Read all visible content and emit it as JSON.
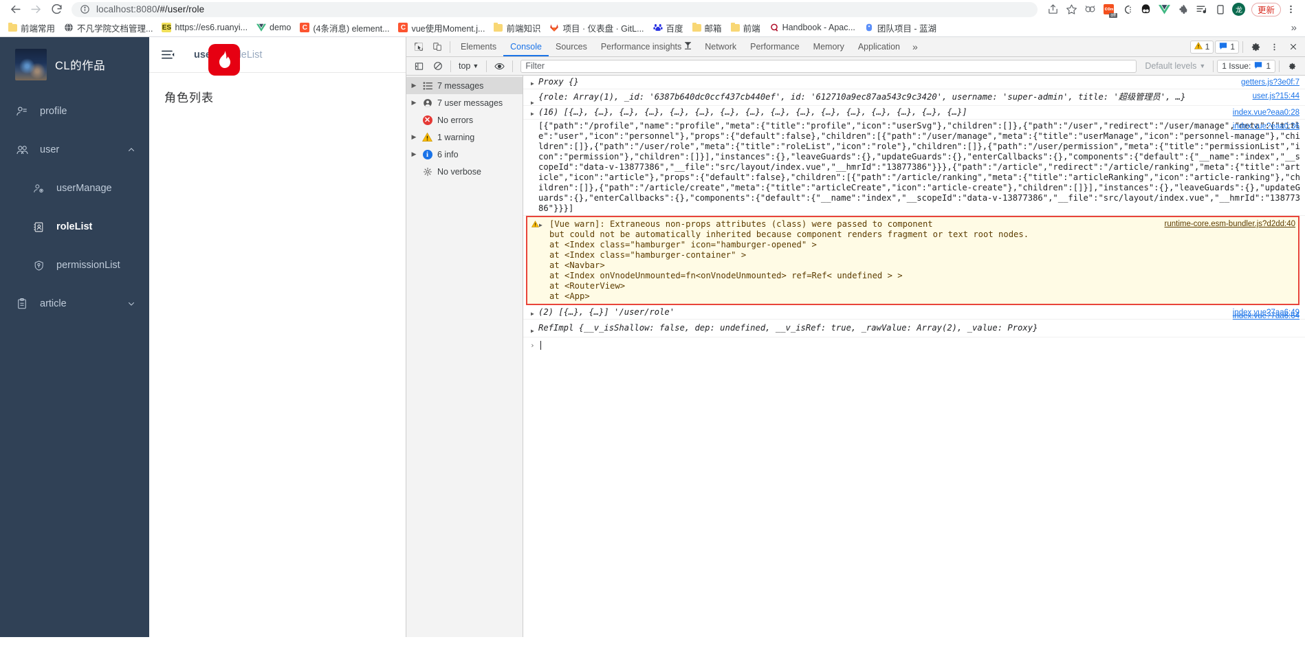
{
  "browser": {
    "nav": {
      "back": "back-arrow",
      "forward": "forward-arrow",
      "reload": "reload"
    },
    "url_prefix": "localhost:8080",
    "url_suffix": "/#/user/role",
    "toolbar_icons": [
      "share-icon",
      "bookmark-star-icon",
      "extension-rings-icon",
      "colorzilla-off-icon",
      "clipboard-icon",
      "panda-icon",
      "vue-devtools-icon",
      "puzzle-extension-icon",
      "reading-list-icon",
      "sidebar-icon",
      "profile-avatar-icon"
    ],
    "avatar_label": "龙",
    "update_label": "更新",
    "menu_icon": "kebab-menu-icon",
    "bookmarks": [
      {
        "label": "前端常用",
        "icon": "folder"
      },
      {
        "label": "不凡学院文档管理...",
        "icon": "globe"
      },
      {
        "label": "https://es6.ruanyi...",
        "icon": "es"
      },
      {
        "label": "demo",
        "icon": "vue"
      },
      {
        "label": "(4条消息) element...",
        "icon": "csdn"
      },
      {
        "label": "vue使用Moment.j...",
        "icon": "csdn"
      },
      {
        "label": "前端知识",
        "icon": "folder"
      },
      {
        "label": "项目 · 仪表盘 · GitL...",
        "icon": "gitlab"
      },
      {
        "label": "百度",
        "icon": "baidu"
      },
      {
        "label": "邮箱",
        "icon": "folder"
      },
      {
        "label": "前端",
        "icon": "folder"
      },
      {
        "label": "Handbook - Apac...",
        "icon": "apache"
      },
      {
        "label": "团队项目 - 蓝湖",
        "icon": "lanhu"
      }
    ],
    "bookmarks_overflow": "»"
  },
  "webapp": {
    "logo_title": "CL的作品",
    "menu": [
      {
        "label": "profile",
        "icon": "user-profile-icon",
        "level": "top",
        "active": false,
        "expandable": false
      },
      {
        "label": "user",
        "icon": "users-icon",
        "level": "top",
        "active": false,
        "expandable": true,
        "arrow": "chevron-up"
      },
      {
        "label": "userManage",
        "icon": "user-gear-icon",
        "level": "sub",
        "active": false,
        "expandable": false
      },
      {
        "label": "roleList",
        "icon": "role-card-icon",
        "level": "sub",
        "active": true,
        "expandable": false
      },
      {
        "label": "permissionList",
        "icon": "shield-key-icon",
        "level": "sub",
        "active": false,
        "expandable": false
      },
      {
        "label": "article",
        "icon": "clipboard-icon",
        "level": "top",
        "active": false,
        "expandable": true,
        "arrow": "chevron-down"
      }
    ],
    "hamburger_icon": "hamburger-collapse-icon",
    "breadcrumb": {
      "parent": "user",
      "separator": "/",
      "current": "roleList"
    },
    "page_title": "角色列表",
    "fire_badge": "fire-icon"
  },
  "devtools": {
    "tools": [
      "inspect-element-icon",
      "device-toolbar-icon"
    ],
    "tabs": [
      {
        "label": "Elements",
        "active": false
      },
      {
        "label": "Console",
        "active": true
      },
      {
        "label": "Sources",
        "active": false
      },
      {
        "label": "Performance insights",
        "active": false,
        "badge": "funnel-icon"
      },
      {
        "label": "Network",
        "active": false
      },
      {
        "label": "Performance",
        "active": false
      },
      {
        "label": "Memory",
        "active": false
      },
      {
        "label": "Application",
        "active": false
      }
    ],
    "more_tabs": "»",
    "warning_count": "1",
    "issue_count": "1",
    "settings_icon": "gear-icon",
    "menu_icon": "kebab-menu-icon",
    "close_icon": "close-icon",
    "filterbar": {
      "sidebar_toggle_icon": "console-sidebar-icon",
      "clear_icon": "clear-console-icon",
      "context": "top",
      "context_caret": "▼",
      "eye_icon": "live-expression-icon",
      "filter_placeholder": "Filter",
      "levels_label": "Default levels",
      "levels_caret": "▼",
      "issues_label": "1 Issue:",
      "issues_count": "1",
      "settings_icon": "console-settings-icon"
    },
    "sidebar": [
      {
        "label": "7 messages",
        "icon": "list-icon",
        "tri": true,
        "selected": true
      },
      {
        "label": "7 user messages",
        "icon": "user-icon",
        "tri": true,
        "selected": false
      },
      {
        "label": "No errors",
        "icon": "error-icon",
        "tri": false,
        "selected": false
      },
      {
        "label": "1 warning",
        "icon": "warning-icon",
        "tri": true,
        "selected": false
      },
      {
        "label": "6 info",
        "icon": "info-icon",
        "tri": true,
        "selected": false
      },
      {
        "label": "No verbose",
        "icon": "verbose-icon",
        "tri": false,
        "selected": false
      }
    ],
    "messages": [
      {
        "type": "log",
        "tri": true,
        "text": "Proxy {}",
        "source": "getters.js?3e0f:7"
      },
      {
        "type": "log",
        "tri": true,
        "text": "{role: Array(1), _id: '6387b640dc0ccf437cb440ef', id: '612710a9ec87aa543c9c3420', username: 'super-admin', title: '超级管理员', …}",
        "source": "user.js?15:44"
      },
      {
        "type": "log",
        "tri": true,
        "text": "(16) [{…}, {…}, {…}, {…}, {…}, {…}, {…}, {…}, {…}, {…}, {…}, {…}, {…}, {…}, {…}, {…}]",
        "source": "index.vue?eaa0:28"
      },
      {
        "type": "log",
        "tri": false,
        "text": "[{\"path\":\"/profile\",\"name\":\"profile\",\"meta\":{\"title\":\"profile\",\"icon\":\"userSvg\"},\"children\":[]},{\"path\":\"/user\",\"redirect\":\"/user/manage\",\"meta\":{\"title\":\"user\",\"icon\":\"personnel\"},\"props\":{\"default\":false},\"children\":[{\"path\":\"/user/manage\",\"meta\":{\"title\":\"userManage\",\"icon\":\"personnel-manage\"},\"children\":[]},{\"path\":\"/user/role\",\"meta\":{\"title\":\"roleList\",\"icon\":\"role\"},\"children\":[]},{\"path\":\"/user/permission\",\"meta\":{\"title\":\"permissionList\",\"icon\":\"permission\"},\"children\":[]}],\"instances\":{},\"leaveGuards\":{},\"updateGuards\":{},\"enterCallbacks\":{},\"components\":{\"default\":{\"__name\":\"index\",\"__scopeId\":\"data-v-13877386\",\"__file\":\"src/layout/index.vue\",\"__hmrId\":\"13877386\"}}},{\"path\":\"/article\",\"redirect\":\"/article/ranking\",\"meta\":{\"title\":\"article\",\"icon\":\"article\"},\"props\":{\"default\":false},\"children\":[{\"path\":\"/article/ranking\",\"meta\":{\"title\":\"articleRanking\",\"icon\":\"article-ranking\"},\"children\":[]},{\"path\":\"/article/create\",\"meta\":{\"title\":\"articleCreate\",\"icon\":\"article-create\"},\"children\":[]}],\"instances\":{},\"leaveGuards\":{},\"updateGuards\":{},\"enterCallbacks\":{},\"components\":{\"default\":{\"__name\":\"index\",\"__scopeId\":\"data-v-13877386\",\"__file\":\"src/layout/index.vue\",\"__hmrId\":\"13877386\"}}}]",
        "source": "index.vue?eaa0:36"
      },
      {
        "type": "warning",
        "tri": true,
        "head": "[Vue warn]: Extraneous non-props attributes (class) were passed to component",
        "head_link": "runtime-core.esm-bundler.js?d2dd:40",
        "head2": "but could not be automatically inherited because component renders fragment or text root nodes.",
        "stack": [
          "  at <Index class=\"hamburger\" icon=\"hamburger-opened\"  >",
          "  at <Index class=\"hamburger-container\"  >",
          "  at <Navbar>",
          "  at <Index onVnodeUnmounted=fn<onVnodeUnmounted> ref=Ref< undefined > >",
          "  at <RouterView>",
          "  at <App>"
        ]
      },
      {
        "type": "log",
        "tri": true,
        "text": "(2) [{…}, {…}] '/user/role'",
        "source": "index.vue?7aa6:49"
      },
      {
        "type": "log",
        "tri": true,
        "text": "RefImpl {__v_isShallow: false, dep: undefined, __v_isRef: true, _rawValue: Array(2), _value: Proxy}",
        "source": "index.vue?7aa6:64"
      }
    ],
    "prompt": {
      "caret": "›"
    }
  }
}
